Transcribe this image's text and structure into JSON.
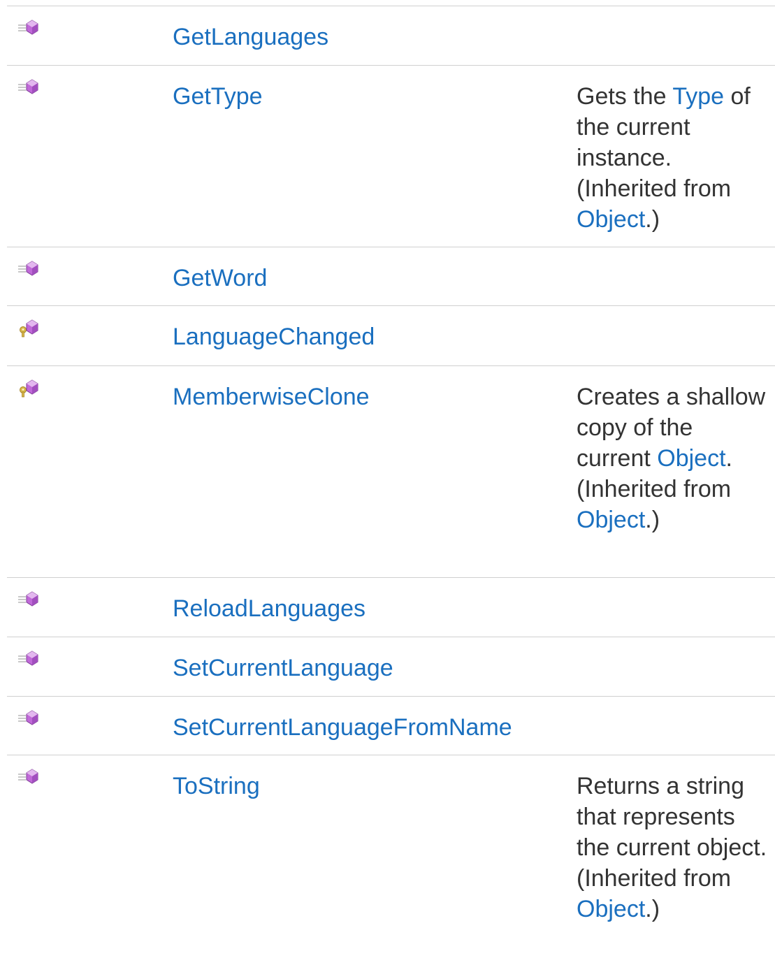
{
  "members": [
    {
      "icon": "public-method-icon",
      "name": "GetLanguages",
      "description": null
    },
    {
      "icon": "public-method-icon",
      "name": "GetType",
      "description": [
        {
          "text": "Gets the "
        },
        {
          "text": "Type",
          "link": true
        },
        {
          "text": " of the current instance. (Inherited from "
        },
        {
          "text": "Object",
          "link": true
        },
        {
          "text": ".)"
        }
      ]
    },
    {
      "icon": "public-method-icon",
      "name": "GetWord",
      "description": null
    },
    {
      "icon": "protected-method-icon",
      "name": "LanguageChanged",
      "description": null
    },
    {
      "icon": "protected-method-icon",
      "name": "MemberwiseClone",
      "description": [
        {
          "text": "Creates a shallow copy of the current "
        },
        {
          "text": "Object",
          "link": true
        },
        {
          "text": ". (Inherited from "
        },
        {
          "text": "Object",
          "link": true
        },
        {
          "text": ".)"
        }
      ]
    },
    {
      "icon": "public-method-icon",
      "name": "ReloadLanguages",
      "description": null
    },
    {
      "icon": "public-method-icon",
      "name": "SetCurrentLanguage",
      "description": null
    },
    {
      "icon": "public-method-icon",
      "name": "SetCurrentLanguageFromName",
      "description": null
    },
    {
      "icon": "public-method-icon",
      "name": "ToString",
      "description": [
        {
          "text": "Returns a string that represents the current object. (Inherited from "
        },
        {
          "text": "Object",
          "link": true
        },
        {
          "text": ".)"
        }
      ]
    }
  ],
  "colors": {
    "link": "#1a6fbf",
    "text": "#333333",
    "border": "#d0d0d0",
    "icon_method": "#c069d8",
    "icon_key": "#d8b84a"
  }
}
